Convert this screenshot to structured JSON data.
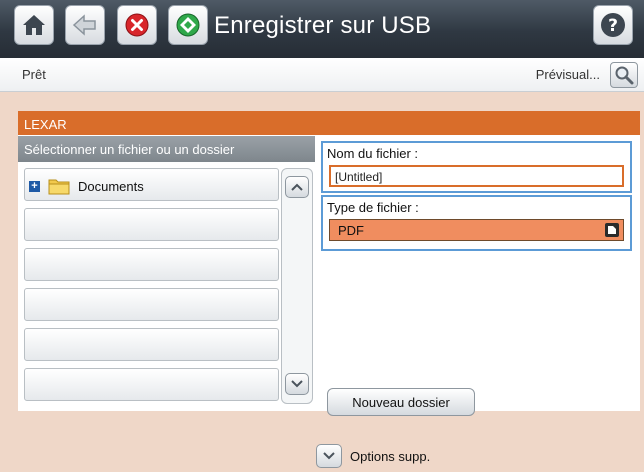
{
  "header": {
    "title": "Enregistrer sur USB",
    "icons": [
      "home-icon",
      "back-icon",
      "stop-icon",
      "start-icon",
      "help-icon"
    ]
  },
  "status": {
    "text": "Prêt",
    "preview_label": "Prévisual...",
    "preview_icon": "magnifier-icon"
  },
  "device": {
    "name": "LEXAR"
  },
  "file_list": {
    "header": "Sélectionner un fichier ou un dossier",
    "items": [
      {
        "label": "Documents",
        "icon": "folder-icon",
        "expand_icon": "plus-icon"
      },
      {
        "label": ""
      },
      {
        "label": ""
      },
      {
        "label": ""
      },
      {
        "label": ""
      },
      {
        "label": ""
      }
    ]
  },
  "file_name": {
    "label": "Nom du fichier :",
    "value": "[Untitled]"
  },
  "file_type": {
    "label": "Type de fichier :",
    "value": "PDF"
  },
  "buttons": {
    "new_folder": "Nouveau dossier",
    "more_options": "Options supp."
  },
  "colors": {
    "accent": "#d96d2a",
    "background": "#efd7c8",
    "focus": "#5c9bd6"
  }
}
